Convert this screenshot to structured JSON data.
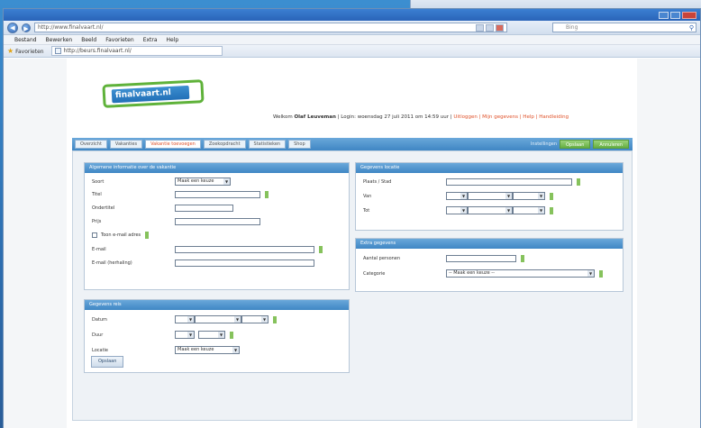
{
  "browser": {
    "url": "http://www.finalvaart.nl/",
    "search_placeholder": "Bing",
    "menu": [
      "Bestand",
      "Bewerken",
      "Beeld",
      "Favorieten",
      "Extra",
      "Help"
    ],
    "favorites_label": "Favorieten",
    "fav_tab": "http://beurs.finalvaart.nl/"
  },
  "site": {
    "logo_text": "finalvaart.nl",
    "welcome_prefix": "Welkom",
    "user": "Olaf Leuveman",
    "welcome_rest": "| Login: woensdag 27 juli 2011 om 14:59 uur |",
    "links": "Uitloggen | Mijn gegevens | Help | Handleiding"
  },
  "tabs": {
    "items": [
      "Overzicht",
      "Vakanties",
      "Vakantie toevoegen",
      "Zoekopdracht",
      "Statistieken",
      "Shop"
    ],
    "active_index": 2,
    "right_label": "Instellingen",
    "btn1": "Opslaan",
    "btn2": "Annuleren"
  },
  "form_general": {
    "title": "Algemene informatie over de vakantie",
    "type_label": "Soort",
    "type_value": "Maak een keuze",
    "title_label": "Titel",
    "subtitle_label": "Ondertitel",
    "price_label": "Prijs",
    "show_email_label": "Toon e-mail adres",
    "email_label": "E-mail",
    "email2_label": "E-mail (herhaling)"
  },
  "form_trip": {
    "title": "Gegevens reis",
    "date_label": "Datum",
    "duration_label": "Duur",
    "location_label": "Locatie",
    "location_value": "Maak een keuze"
  },
  "form_location": {
    "title": "Gegevens locatie",
    "place_label": "Plaats / Stad",
    "from_label": "Van",
    "to_label": "Tot"
  },
  "form_extra": {
    "title": "Extra gegevens",
    "capacity_label": "Aantal personen",
    "category_label": "Categorie",
    "category_value": "-- Maak een keuze --"
  },
  "add_button": "Opslaan"
}
